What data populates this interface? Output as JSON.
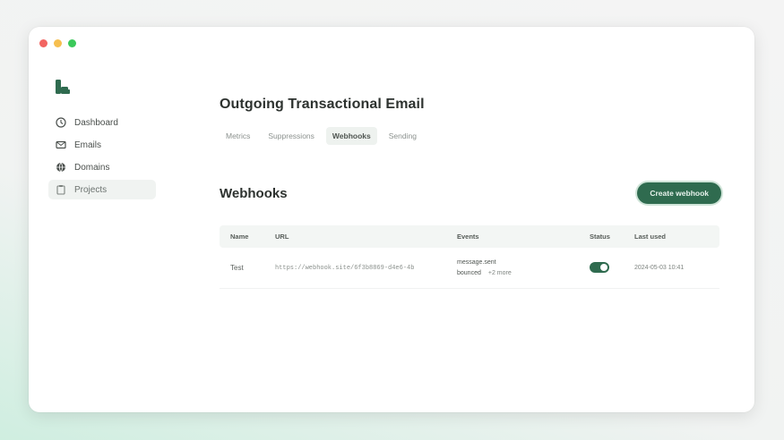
{
  "app": {
    "title": "Outgoing Transactional Email"
  },
  "sidebar": {
    "items": [
      {
        "label": "Dashboard",
        "icon": "clock-icon"
      },
      {
        "label": "Emails",
        "icon": "mail-icon"
      },
      {
        "label": "Domains",
        "icon": "globe-icon"
      },
      {
        "label": "Projects",
        "icon": "clipboard-icon",
        "active": true
      }
    ]
  },
  "tabs": [
    {
      "label": "Metrics"
    },
    {
      "label": "Suppressions"
    },
    {
      "label": "Webhooks",
      "active": true
    },
    {
      "label": "Sending"
    }
  ],
  "webhooks": {
    "title": "Webhooks",
    "create_label": "Create webhook",
    "columns": [
      "Name",
      "URL",
      "Events",
      "Status",
      "Last used"
    ],
    "rows": [
      {
        "name": "Test",
        "url": "https://webhook.site/6f3b8869-d4e6-4b",
        "events": [
          "message.sent",
          "bounced"
        ],
        "more": "+2 more",
        "enabled": true,
        "last_used": "2024-05-03 10:41"
      }
    ]
  },
  "colors": {
    "accent": "#2f6b4f",
    "window_bg": "#ffffff",
    "traffic_red": "#f26461",
    "traffic_yellow": "#f6bf4f",
    "traffic_green": "#3bc95a"
  }
}
